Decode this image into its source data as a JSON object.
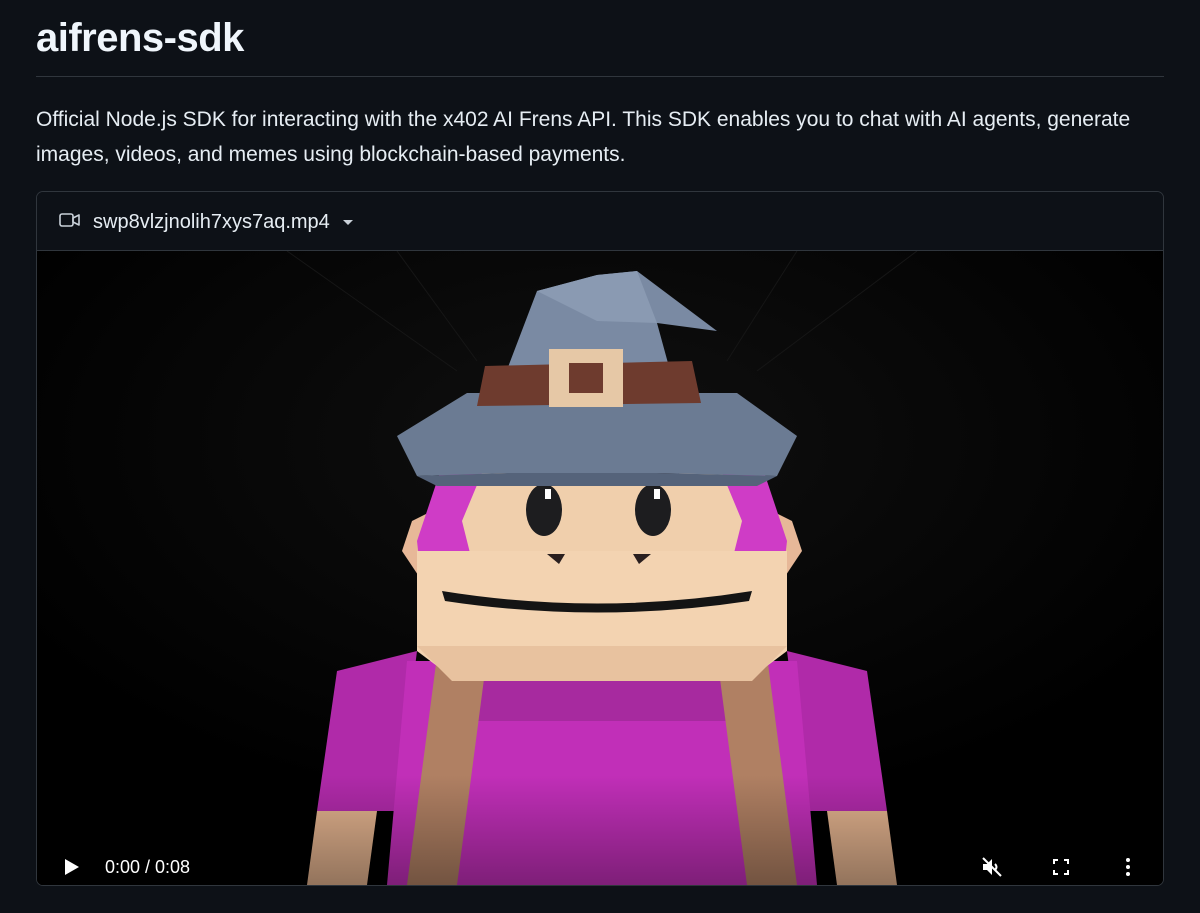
{
  "page": {
    "title": "aifrens-sdk",
    "description": "Official Node.js SDK for interacting with the x402 AI Frens API. This SDK enables you to chat with AI agents, generate images, videos, and memes using blockchain-based payments."
  },
  "attachment": {
    "icon": "video-camera-icon",
    "file_name": "swp8vlzjnolih7xys7aq.mp4",
    "dropdown_icon": "caret-down-icon"
  },
  "video": {
    "frame_description": "",
    "time_display": "0:00 / 0:08",
    "current_time": "0:00",
    "duration": "0:08",
    "progress_fraction": 0.03,
    "muted": true,
    "controls": {
      "play_icon": "play-icon",
      "mute_icon": "muted-speaker-icon",
      "fullscreen_icon": "fullscreen-icon",
      "more_icon": "more-vertical-icon"
    }
  },
  "colors": {
    "background": "#0d1117",
    "border": "#30363d",
    "text": "#e6edf3",
    "hat": "#6b7b93",
    "hat_band": "#6e3b2e",
    "buckle": "#e6c8a6",
    "fur": "#d23ac8",
    "skin": "#f0cfac",
    "shirt": "#c12fb8",
    "strap": "#b08063"
  }
}
